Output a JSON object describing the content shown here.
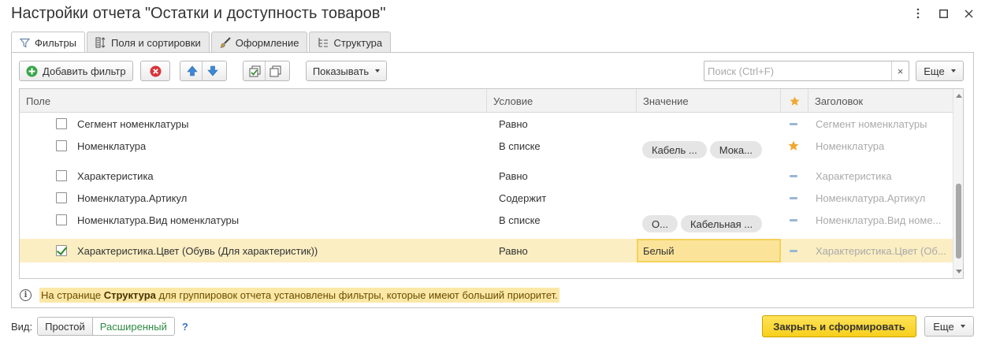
{
  "window": {
    "title": "Настройки отчета \"Остатки и доступность товаров\"",
    "controls": [
      "more-vertical-icon",
      "maximize-icon",
      "close-icon"
    ]
  },
  "tabs": [
    {
      "label": "Фильтры",
      "icon": "filter-icon",
      "active": true
    },
    {
      "label": "Поля и сортировки",
      "icon": "columns-sort-icon",
      "active": false
    },
    {
      "label": "Оформление",
      "icon": "brush-icon",
      "active": false
    },
    {
      "label": "Структура",
      "icon": "structure-icon",
      "active": false
    }
  ],
  "toolbar": {
    "add_filter_label": "Добавить фильтр",
    "show_label": "Показывать",
    "search_placeholder": "Поиск (Ctrl+F)",
    "more_label": "Еще"
  },
  "table": {
    "headers": {
      "field": "Поле",
      "condition": "Условие",
      "value": "Значение",
      "heading": "Заголовок"
    },
    "rows": [
      {
        "checked": false,
        "field": "Сегмент номенклатуры",
        "condition": "Равно",
        "values": [],
        "mark": "minus",
        "heading": "Сегмент номенклатуры"
      },
      {
        "checked": false,
        "field": "Номенклатура",
        "condition": "В списке",
        "values": [
          "Кабель ...",
          "Мока..."
        ],
        "mark": "star",
        "heading": "Номенклатура"
      },
      {
        "checked": false,
        "field": "Характеристика",
        "condition": "Равно",
        "values": [],
        "mark": "minus",
        "heading": "Характеристика"
      },
      {
        "checked": false,
        "field": "Номенклатура.Артикул",
        "condition": "Содержит",
        "values": [],
        "mark": "minus",
        "heading": "Номенклатура.Артикул"
      },
      {
        "checked": false,
        "field": "Номенклатура.Вид номенклатуры",
        "condition": "В списке",
        "values": [
          "О...",
          "Кабельная ..."
        ],
        "mark": "minus",
        "heading": "Номенклатура.Вид номе..."
      },
      {
        "checked": true,
        "field": "Характеристика.Цвет (Обувь (Для характеристик))",
        "condition": "Равно",
        "value_text": "Белый",
        "mark": "minus",
        "heading": "Характеристика.Цвет (Об..."
      }
    ]
  },
  "info": {
    "prefix": "На странице ",
    "bold": "Структура",
    "suffix": " для группировок отчета установлены фильтры, которые имеют больший приоритет."
  },
  "footer": {
    "view_label": "Вид:",
    "simple_label": "Простой",
    "advanced_label": "Расширенный",
    "help_label": "?",
    "primary_label": "Закрыть и сформировать",
    "more_label": "Еще"
  },
  "colors": {
    "accent_yellow": "#f7cf1a",
    "selected_row": "#fbeec3",
    "star": "#f0a830",
    "active_green": "#2e8a43"
  }
}
